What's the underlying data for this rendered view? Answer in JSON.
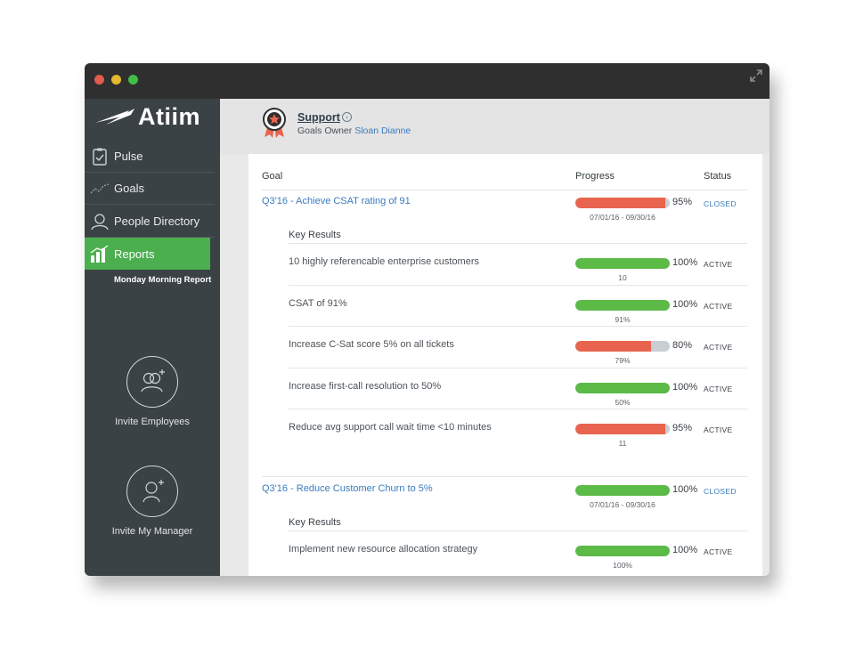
{
  "app": {
    "logo_text": "Atiim"
  },
  "sidebar": {
    "items": [
      {
        "label": "Pulse",
        "icon": "clipboard-icon"
      },
      {
        "label": "Goals",
        "icon": "trend-line-icon"
      },
      {
        "label": "People Directory",
        "icon": "people-icon"
      },
      {
        "label": "Reports",
        "icon": "bar-chart-icon",
        "active": true
      }
    ],
    "sub_item": "Monday Morning Report",
    "invite_employees": "Invite Employees",
    "invite_manager": "Invite My Manager"
  },
  "header": {
    "team": "Support",
    "owner_label": "Goals Owner",
    "owner_name": "Sloan Dianne"
  },
  "table": {
    "columns": {
      "goal": "Goal",
      "progress": "Progress",
      "status": "Status"
    },
    "key_results_label": "Key Results",
    "goals": [
      {
        "title": "Q3'16 - Achieve CSAT rating of 91",
        "progress": 95,
        "percent_label": "95%",
        "dates": "07/01/16 - 09/30/16",
        "status": "CLOSED",
        "bar_color": "#e8644e",
        "key_results": [
          {
            "title": "10 highly referencable enterprise customers",
            "progress": 100,
            "percent_label": "100%",
            "value": "10",
            "status": "ACTIVE",
            "bar_color": "#5cba47"
          },
          {
            "title": "CSAT of 91%",
            "progress": 100,
            "percent_label": "100%",
            "value": "91%",
            "status": "ACTIVE",
            "bar_color": "#5cba47"
          },
          {
            "title": "Increase C-Sat score 5% on all tickets",
            "progress": 80,
            "percent_label": "80%",
            "value": "79%",
            "status": "ACTIVE",
            "bar_color": "#e8644e"
          },
          {
            "title": "Increase first-call resolution to 50%",
            "progress": 100,
            "percent_label": "100%",
            "value": "50%",
            "status": "ACTIVE",
            "bar_color": "#5cba47"
          },
          {
            "title": "Reduce avg support call wait time <10 minutes",
            "progress": 95,
            "percent_label": "95%",
            "value": "11",
            "status": "ACTIVE",
            "bar_color": "#e8644e"
          }
        ]
      },
      {
        "title": "Q3'16 - Reduce Customer Churn to 5%",
        "progress": 100,
        "percent_label": "100%",
        "dates": "07/01/16 - 09/30/16",
        "status": "CLOSED",
        "bar_color": "#5cba47",
        "key_results": [
          {
            "title": "Implement new resource allocation strategy",
            "progress": 100,
            "percent_label": "100%",
            "value": "100%",
            "status": "ACTIVE",
            "bar_color": "#5cba47"
          }
        ]
      }
    ]
  }
}
